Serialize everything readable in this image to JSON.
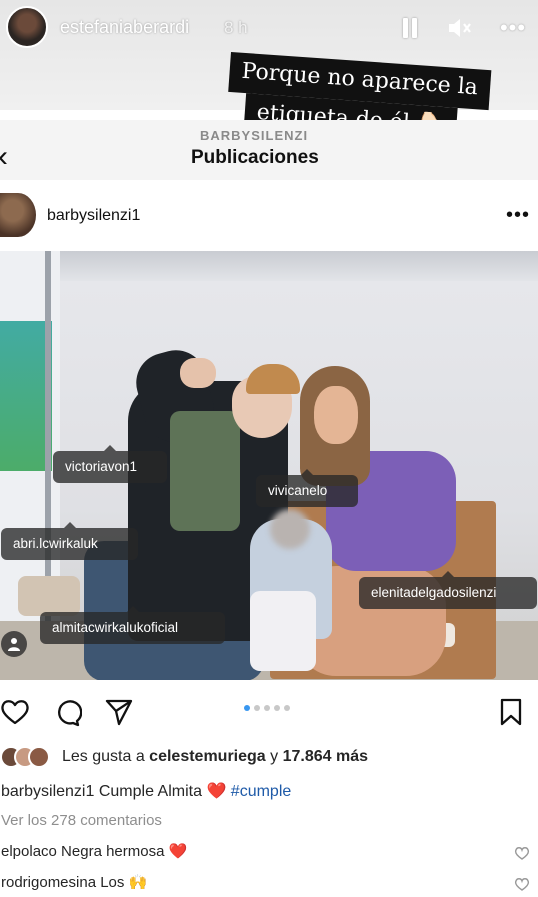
{
  "story": {
    "username": "estefaniaberardi",
    "time": "8 h",
    "sticker_line1": "Porque no aparece la",
    "sticker_line2": "etiqueta de él 👇🏻"
  },
  "nav": {
    "subtitle": "BARBYSILENZI",
    "title": "Publicaciones",
    "back": "‹"
  },
  "post": {
    "username": "barbysilenzi1",
    "more": "•••",
    "tags": [
      "victoriavon1",
      "vivicanelo",
      "abri.lcwirkaluk",
      "almitacwirkalukoficial",
      "elenitadelgadosilenzi"
    ],
    "carousel_dots": 5,
    "carousel_active": 1
  },
  "likes": {
    "prefix": "Les gusta a ",
    "user": "celestemuriega",
    "middle": " y ",
    "count": "17.864 más"
  },
  "caption": {
    "user": "barbysilenzi1",
    "text": " Cumple Almita ",
    "emoji": "❤️",
    "hashtag": " #cumple"
  },
  "view_comments": "Ver los 278 comentarios",
  "comments": [
    {
      "user": "elpolaco",
      "text": " Negra hermosa ",
      "emoji": "❤️"
    },
    {
      "user": "rodrigomesina",
      "text": " Los ",
      "emoji": "🙌"
    }
  ],
  "colors": {
    "link": "#1e5aa8",
    "carousel_active": "#3897f0",
    "tag_bg": "rgba(40,40,40,.78)"
  }
}
